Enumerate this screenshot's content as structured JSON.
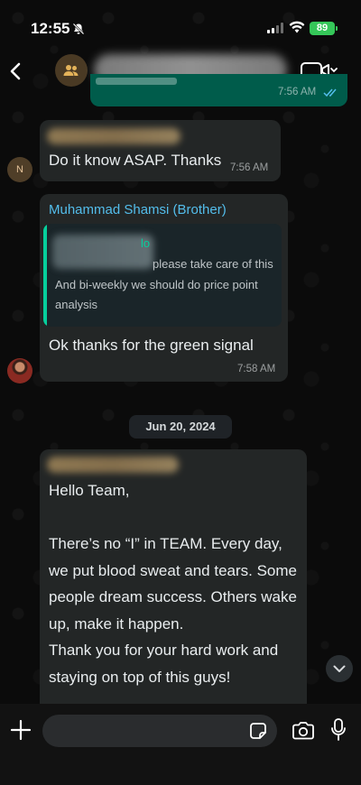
{
  "status_bar": {
    "time": "12:55",
    "battery": "89"
  },
  "header": {
    "back_label": "",
    "group_name": ""
  },
  "messages": [
    {
      "time": "7:56 AM",
      "sender": "",
      "text": ""
    },
    {
      "sender": "",
      "avatar_initial": "N",
      "text": "Do it know ASAP. Thanks",
      "time": "7:56 AM"
    },
    {
      "sender": "Muhammad Shamsi (Brother)",
      "quote_tail_line1": "lo",
      "quote_line2": "please take care of this",
      "quote_line3": "And bi-weekly we should do price point",
      "quote_line4": "analysis",
      "text": "Ok thanks for the green signal",
      "time": "7:58 AM"
    },
    {
      "sender": "",
      "lines": [
        "Hello Team,",
        "",
        "There’s no “I” in TEAM. Every day,",
        "we put blood sweat and tears. Some",
        "people dream success. Others wake",
        "up, make it happen.",
        "Thank you for your hard work and",
        "staying on top of this guys!"
      ]
    }
  ],
  "date_separator": "Jun 20, 2024",
  "composer": {
    "placeholder": ""
  },
  "colors": {
    "incoming_bubble": "#232626",
    "outgoing_bubble": "#005c4b",
    "sender_name": "#53bdeb",
    "quote_bar": "#06cf9c",
    "read_ticks": "#53bdeb"
  }
}
